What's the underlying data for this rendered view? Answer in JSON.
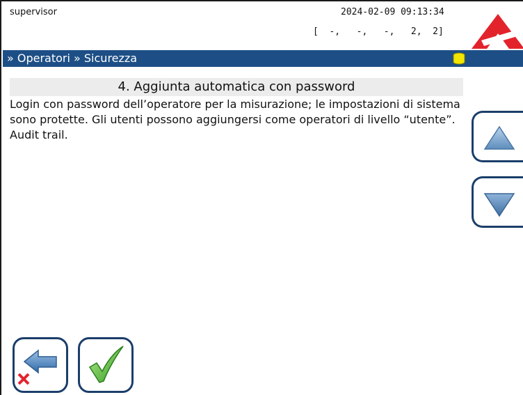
{
  "status": {
    "user": "supervisor",
    "datetime": "2024-02-09 09:13:34",
    "counters": "[  -,   -,   -,   2,  2]"
  },
  "nav": {
    "breadcrumb": "» Operatori » Sicurezza",
    "database_icon": "database-icon",
    "database_icon_color": "#f2e600"
  },
  "content": {
    "title": "4. Aggiunta automatica con password",
    "description": "Login con password dell’operatore per la misurazione; le impostazioni di sistema sono protette. Gli utenti possono aggiungersi come operatori di livello “utente”. Audit trail."
  },
  "controls": {
    "scroll_up_icon": "triangle-up-icon",
    "scroll_down_icon": "triangle-down-icon",
    "back_icon": "back-arrow-cancel-icon",
    "confirm_icon": "checkmark-icon"
  },
  "colors": {
    "nav_bar": "#1d4f86",
    "button_border": "#1b3e6a",
    "logo_red": "#e3232b",
    "checkmark_green": "#4cc22e"
  }
}
